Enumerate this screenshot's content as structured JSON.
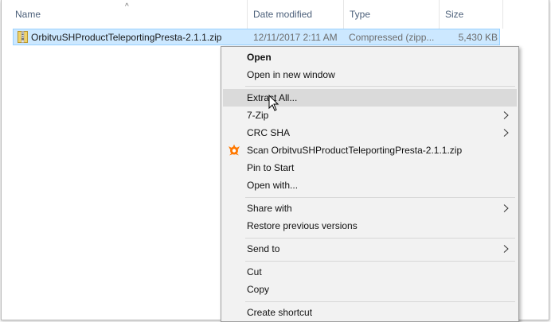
{
  "columns": {
    "name": "Name",
    "date_modified": "Date modified",
    "type": "Type",
    "size": "Size"
  },
  "file": {
    "name": "OrbitvuSHProductTeleportingPresta-2.1.1.zip",
    "date_modified": "12/11/2017 2:11 AM",
    "type": "Compressed (zipp...",
    "size": "5,430 KB",
    "icon": "zip-folder-icon"
  },
  "context_menu": {
    "items": [
      {
        "label": "Open",
        "bold": true
      },
      {
        "label": "Open in new window"
      },
      {
        "label": "Extract All...",
        "hovered": true
      },
      {
        "label": "7-Zip",
        "submenu": true
      },
      {
        "label": "CRC SHA",
        "submenu": true
      },
      {
        "label": "Scan OrbitvuSHProductTeleportingPresta-2.1.1.zip",
        "icon": "avast-icon",
        "icon_color": "#ff7800"
      },
      {
        "label": "Pin to Start"
      },
      {
        "label": "Open with..."
      },
      {
        "label": "Share with",
        "submenu": true
      },
      {
        "label": "Restore previous versions"
      },
      {
        "label": "Send to",
        "submenu": true
      },
      {
        "label": "Cut"
      },
      {
        "label": "Copy"
      },
      {
        "label": "Create shortcut"
      }
    ]
  },
  "colors": {
    "selection_bg": "#cce8ff",
    "selection_border": "#99d1ff",
    "header_text": "#4c607a",
    "menu_bg": "#f2f2f2",
    "menu_hover": "#dadada"
  }
}
